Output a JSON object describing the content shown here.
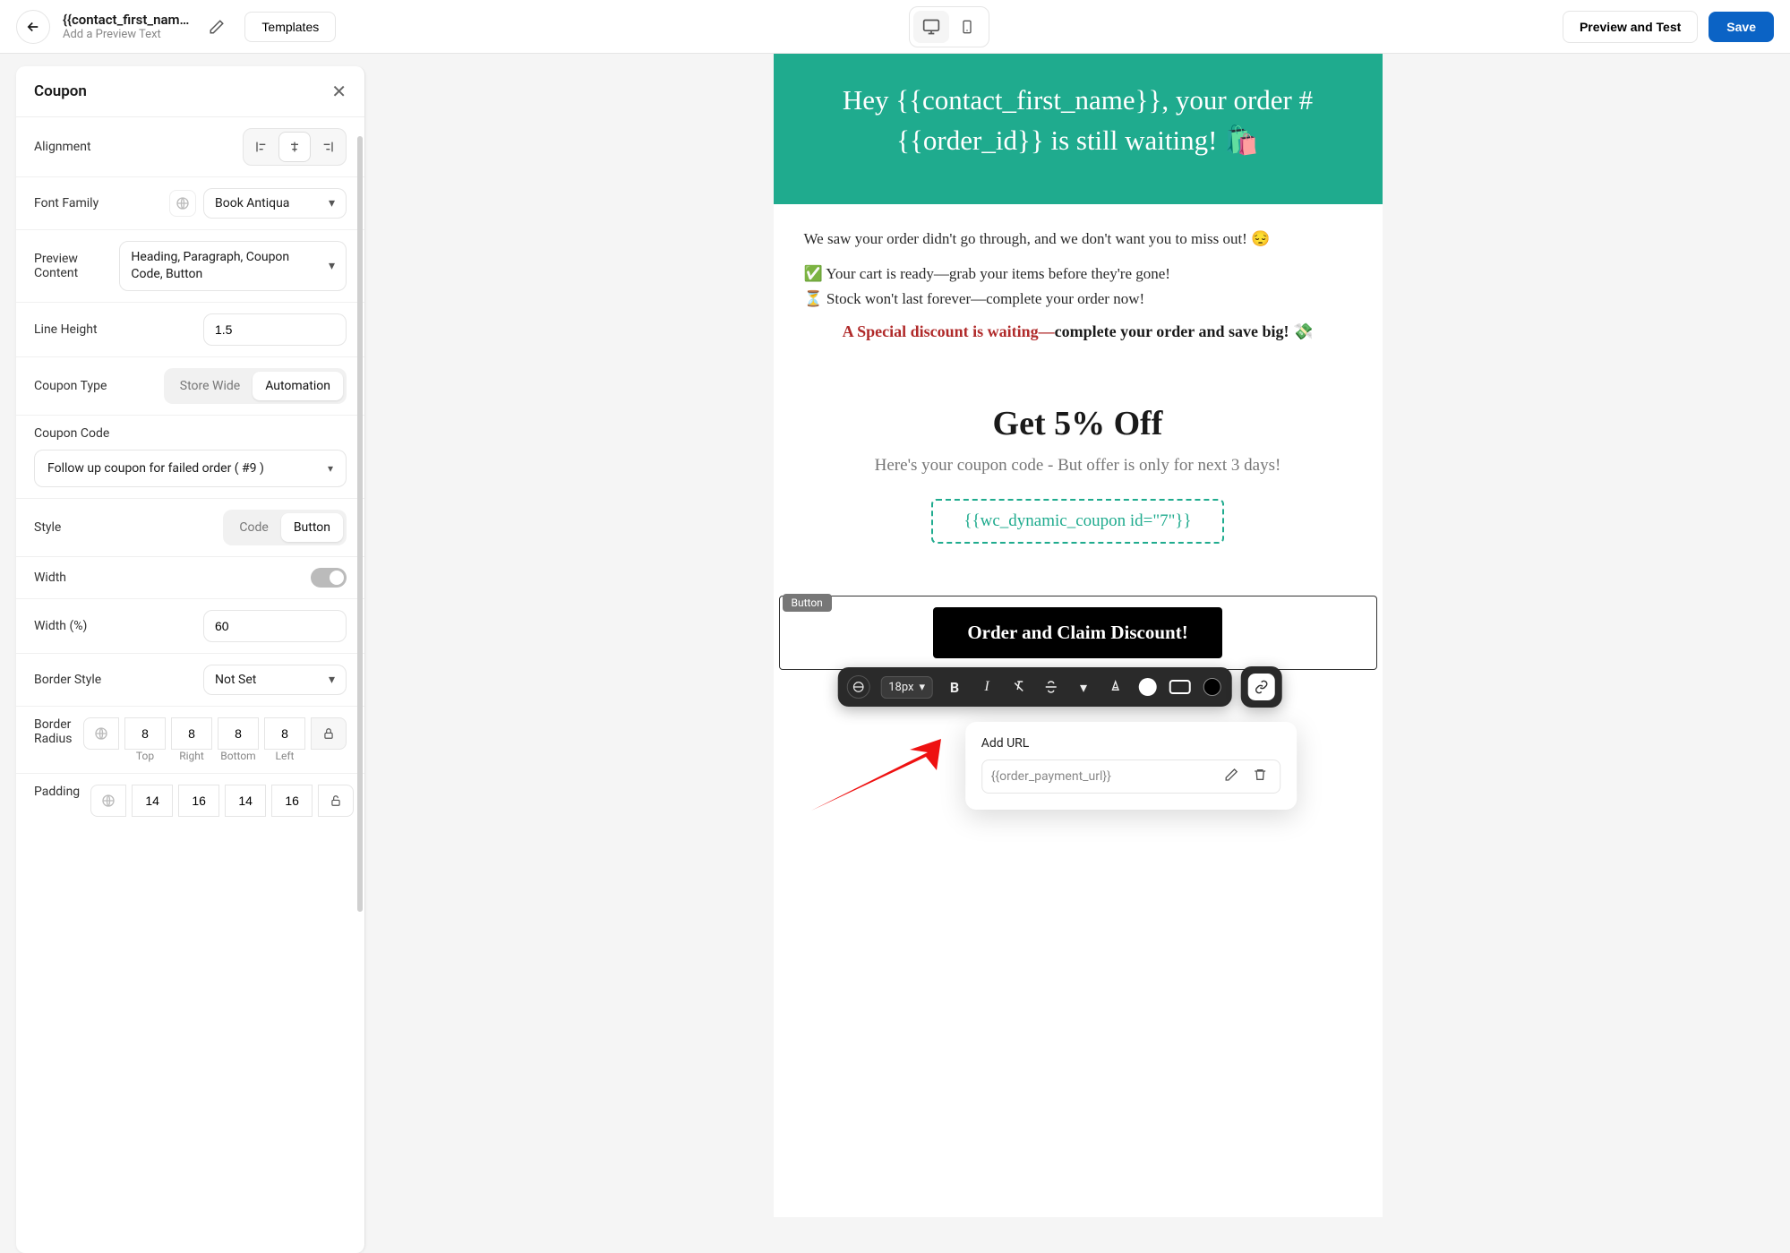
{
  "topbar": {
    "subject": "{{contact_first_nam…",
    "preview_text": "Add a Preview Text",
    "templates": "Templates",
    "preview_test": "Preview and Test",
    "save": "Save"
  },
  "panel": {
    "title": "Coupon",
    "alignment_label": "Alignment",
    "font_family_label": "Font Family",
    "font_family_value": "Book Antiqua",
    "preview_content_label": "Preview Content",
    "preview_content_value": "Heading, Paragraph, Coupon Code, Button",
    "line_height_label": "Line Height",
    "line_height_value": "1.5",
    "coupon_type_label": "Coupon Type",
    "coupon_type_store": "Store Wide",
    "coupon_type_auto": "Automation",
    "coupon_code_label": "Coupon Code",
    "coupon_code_value": "Follow up coupon for failed order ( #9 )",
    "style_label": "Style",
    "style_code": "Code",
    "style_button": "Button",
    "width_label": "Width",
    "width_pct_label": "Width (%)",
    "width_pct_value": "60",
    "border_style_label": "Border Style",
    "border_style_value": "Not Set",
    "border_radius_label": "Border Radius",
    "br_top": "8",
    "br_right": "8",
    "br_bottom": "8",
    "br_left": "8",
    "lbl_top": "Top",
    "lbl_right": "Right",
    "lbl_bottom": "Bottom",
    "lbl_left": "Left",
    "padding_label": "Padding",
    "pd_top": "14",
    "pd_right": "16",
    "pd_bottom": "14",
    "pd_left": "16"
  },
  "email": {
    "hero": "Hey {{contact_first_name}}, your order #{{order_id}} is still waiting! 🛍️",
    "p1": "We saw your order didn't go through, and we don't want you to miss out! 😔",
    "p2": "✅ Your cart is ready—grab your items before they're gone!",
    "p3": "⏳ Stock won't last forever—complete your order now!",
    "hl_red": "A Special discount is waiting—",
    "hl_bold": "complete your order and save big! 💸",
    "coupon_h": "Get 5% Off",
    "coupon_sub": "Here's your coupon code - But offer is only for next 3 days!",
    "coupon_code": "{{wc_dynamic_coupon id=\"7\"}}",
    "block_tag": "Button",
    "cta": "Order and Claim Discount!"
  },
  "toolbar": {
    "font_size": "18px"
  },
  "url_pop": {
    "label": "Add URL",
    "value": "{{order_payment_url}}"
  }
}
